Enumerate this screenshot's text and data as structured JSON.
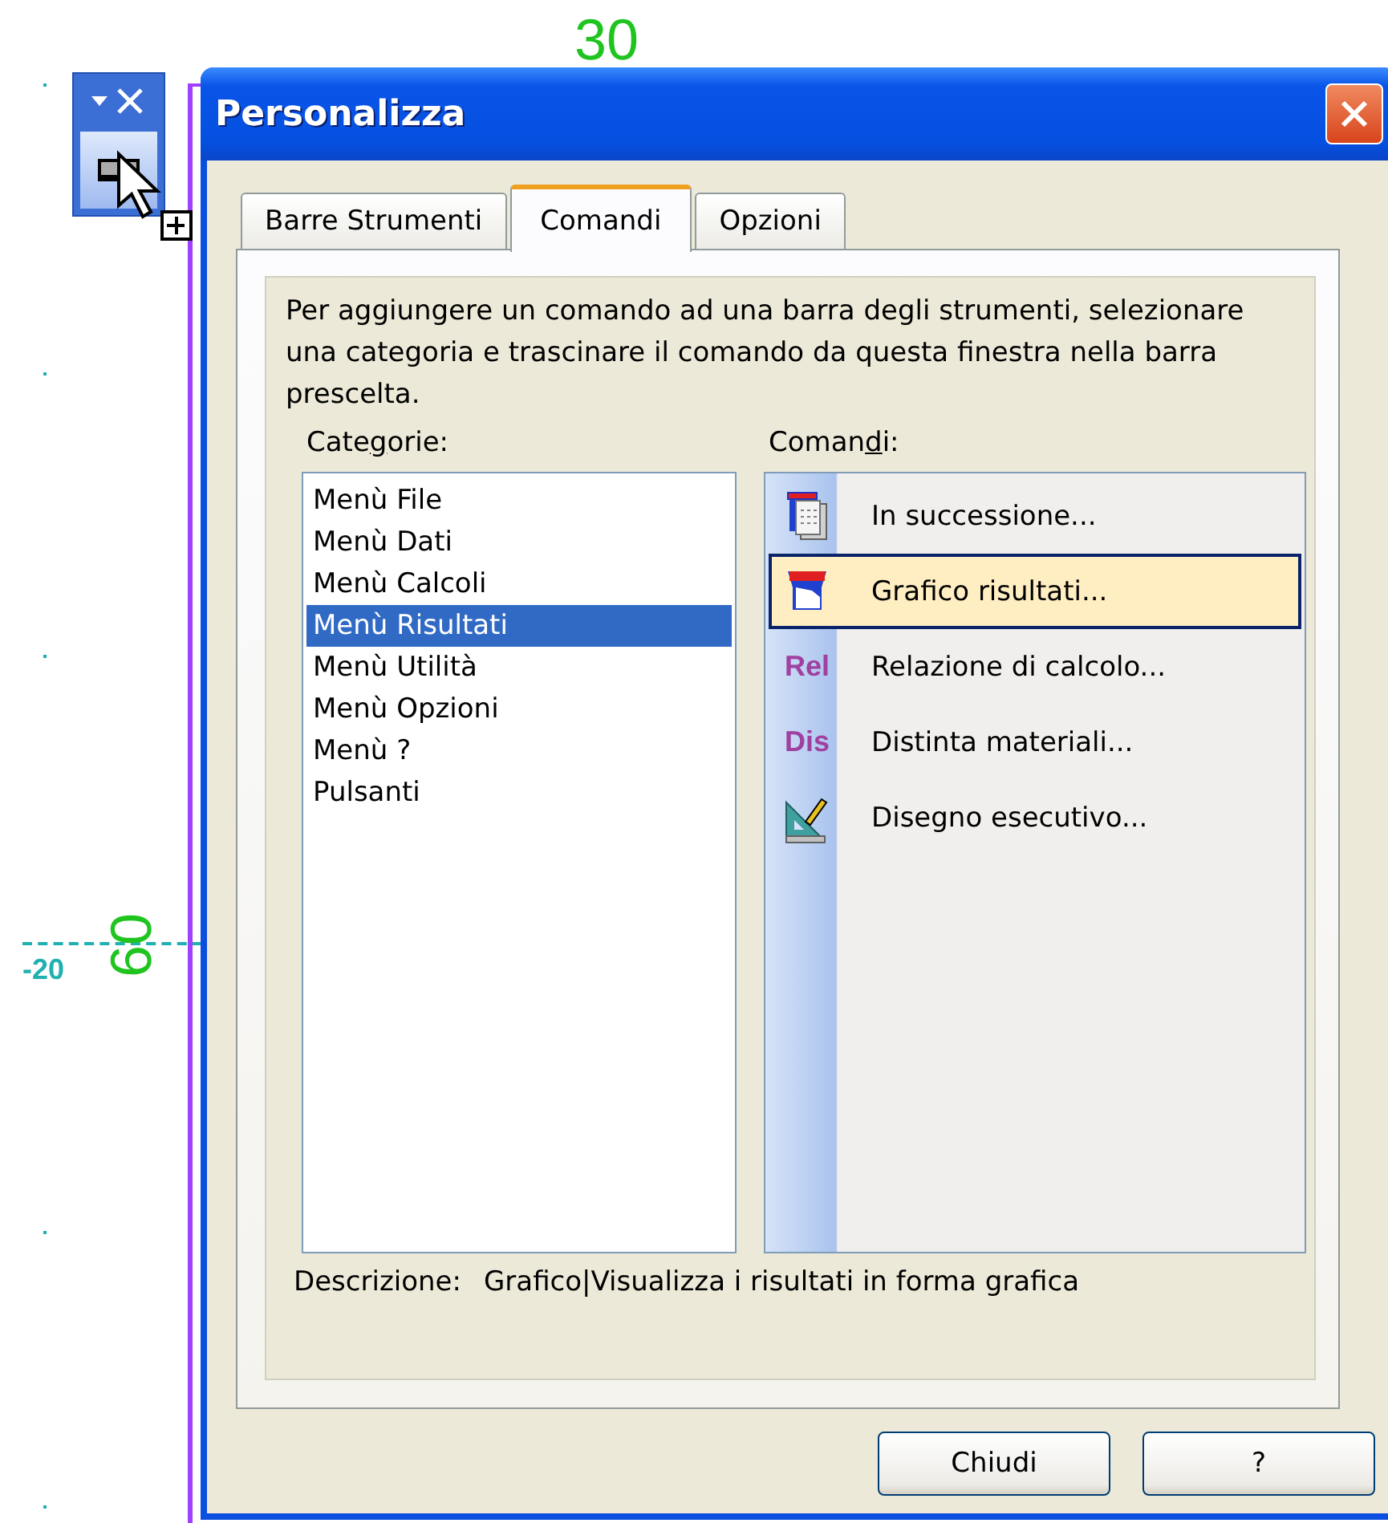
{
  "canvas": {
    "top_dimension": "30",
    "side_dimension": "60",
    "coordinate_label": "-20"
  },
  "window": {
    "title": "Personalizza"
  },
  "tabs": [
    {
      "label": "Barre Strumenti",
      "selected": false
    },
    {
      "label": "Comandi",
      "selected": true
    },
    {
      "label": "Opzioni",
      "selected": false
    }
  ],
  "instructions": "Per aggiungere un comando ad una barra degli strumenti, selezionare una categoria e trascinare il comando da questa finestra nella barra prescelta.",
  "categories": {
    "label": {
      "before": "Cate",
      "key": "g",
      "after": "orie:"
    },
    "items": [
      {
        "label": "Menù File",
        "selected": false
      },
      {
        "label": "Menù Dati",
        "selected": false
      },
      {
        "label": "Menù Calcoli",
        "selected": false
      },
      {
        "label": "Menù Risultati",
        "selected": true
      },
      {
        "label": "Menù Utilità",
        "selected": false
      },
      {
        "label": "Menù Opzioni",
        "selected": false
      },
      {
        "label": "Menù ?",
        "selected": false
      },
      {
        "label": "Pulsanti",
        "selected": false
      }
    ]
  },
  "commands": {
    "label": {
      "before": "Coman",
      "key": "d",
      "after": "i:"
    },
    "items": [
      {
        "label": "In successione...",
        "kind": "sheets",
        "selected": false
      },
      {
        "label": "Grafico risultati...",
        "kind": "chart",
        "selected": true
      },
      {
        "label": "Relazione di calcolo...",
        "kind": "text",
        "icon_text": "Rel",
        "selected": false
      },
      {
        "label": "Distinta materiali...",
        "kind": "text",
        "icon_text": "Dis",
        "selected": false
      },
      {
        "label": "Disegno esecutivo...",
        "kind": "drafting",
        "selected": false
      }
    ]
  },
  "description": {
    "label": "Descrizione:",
    "value": "Grafico|Visualizza i risultati in forma grafica"
  },
  "buttons": [
    "Chiudi",
    "?"
  ]
}
